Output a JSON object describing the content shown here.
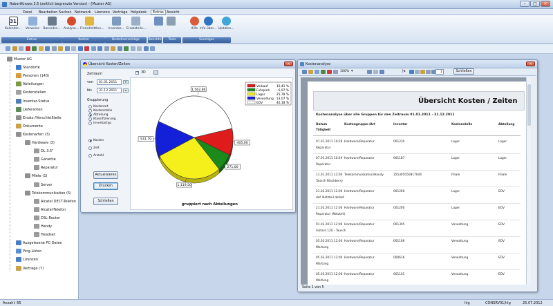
{
  "window": {
    "title": "RobertKnows 3.5 (zeitlich begrenzte Version) - [Muster AG]"
  },
  "menu": [
    "Datei",
    "Bearbeiten",
    "Suchen",
    "Netzwerk",
    "Lizenzen",
    "Verträge",
    "Helpdesk",
    "Extras",
    "Ansicht"
  ],
  "menu_active": "Extras",
  "ribbon": {
    "buttons": [
      {
        "label": "Kalender...",
        "icon": "calendar-icon",
        "badge": "31"
      },
      {
        "label": "Verweise",
        "icon": "links-icon"
      },
      {
        "label": "Barcodes...",
        "icon": "barcode-icon"
      },
      {
        "label": "Analyse...",
        "icon": "analysis-icon"
      },
      {
        "label": "Fremdmittlon...",
        "icon": "finance-icon"
      },
      {
        "label": "Inventar...",
        "icon": "inventory-icon"
      },
      {
        "label": "Ersatzteile...",
        "icon": "spare-parts-icon"
      },
      {
        "label": "",
        "icon": "report-icon"
      },
      {
        "label": "",
        "icon": "tools-icon"
      },
      {
        "label": "Hilfe",
        "icon": "help-icon"
      },
      {
        "label": "Info über...",
        "icon": "info-icon"
      },
      {
        "label": "Updates...",
        "icon": "updates-icon"
      }
    ],
    "groups": [
      "Extras",
      "Kosten",
      "Bestellvorschläge",
      "Berichte",
      "Tools",
      "Sonstiges"
    ]
  },
  "tree": [
    {
      "label": "Muster AG",
      "level": 0,
      "color": "#8c8c8c"
    },
    {
      "label": "Standorte",
      "level": 1,
      "color": "#3c7cc7"
    },
    {
      "label": "Personen (143)",
      "level": 1,
      "color": "#d99b3a"
    },
    {
      "label": "Abteilungen",
      "level": 1,
      "color": "#7a9a3f"
    },
    {
      "label": "Kostenstellen",
      "level": 1,
      "color": "#a0a0a0"
    },
    {
      "label": "Inventar-Status",
      "level": 1,
      "color": "#4f7fb5"
    },
    {
      "label": "Lieferanten",
      "level": 1,
      "color": "#5a8f5a"
    },
    {
      "label": "Ersatz-/Verschleißteile",
      "level": 1,
      "color": "#8f8f8f"
    },
    {
      "label": "Dokumente",
      "level": 1,
      "color": "#c9a34a"
    },
    {
      "label": "Kostenarten (3)",
      "level": 1,
      "color": "#8f8f8f"
    },
    {
      "label": "Hardware (3)",
      "level": 2,
      "color": "#8f8f8f"
    },
    {
      "label": "DL 3.5\"",
      "level": 3,
      "color": "#9a9a9a"
    },
    {
      "label": "Garantie",
      "level": 3,
      "color": "#9a9a9a"
    },
    {
      "label": "Reparatur",
      "level": 3,
      "color": "#9a9a9a"
    },
    {
      "label": "Miete (1)",
      "level": 2,
      "color": "#8f8f8f"
    },
    {
      "label": "Server",
      "level": 3,
      "color": "#9a9a9a"
    },
    {
      "label": "Telekommunikation (5)",
      "level": 2,
      "color": "#8f8f8f"
    },
    {
      "label": "Alcatel DECT-Telefon",
      "level": 3,
      "color": "#9a9a9a"
    },
    {
      "label": "Alcatel-Telefon",
      "level": 3,
      "color": "#9a9a9a"
    },
    {
      "label": "DSL-Router",
      "level": 3,
      "color": "#9a9a9a"
    },
    {
      "label": "Handy",
      "level": 3,
      "color": "#9a9a9a"
    },
    {
      "label": "Headset",
      "level": 3,
      "color": "#9a9a9a"
    },
    {
      "label": "Ausgelesene PC-Daten",
      "level": 1,
      "color": "#4a7fc4"
    },
    {
      "label": "Ping-Listen",
      "level": 1,
      "color": "#5b8fd0"
    },
    {
      "label": "Lizenzen",
      "level": 1,
      "color": "#4a7fc4"
    },
    {
      "label": "Verträge (7)",
      "level": 1,
      "color": "#c9a34a"
    }
  ],
  "cost_window": {
    "title": "Übersicht Kosten/Zeiten",
    "zeitraum_label": "Zeitraum",
    "von_label": "von",
    "von_value": "01.01.2011",
    "bis_label": "bis",
    "bis_value": "31.12.2011",
    "gruppierung_label": "Gruppierung",
    "gruppierung_options": [
      "Kostenart",
      "Kostenstelle",
      "Abteilung",
      "Klassifizierung",
      "Inventartyp"
    ],
    "gruppierung_selected": 2,
    "mode_options": [
      "Kosten",
      "Zeit",
      "Anzahl"
    ],
    "mode_selected": 0,
    "check_3d": "3D",
    "buttons": {
      "refresh": "Aktualisieren",
      "print": "Drucken",
      "close": "Schließen"
    },
    "caption": "gruppiert nach Abteilungen"
  },
  "chart_data": {
    "type": "pie",
    "categories": [
      "Verkauf",
      "Fuhrpark",
      "Lager",
      "Verwaltung",
      "EDV"
    ],
    "legend_percent": [
      "10,41 %",
      "6,97 %",
      "25,78 %",
      "13,07 %",
      "40,18 %"
    ],
    "values": [
      405.0,
      271.0,
      1119.5,
      531.79,
      1562.86
    ],
    "value_labels": [
      "405,00",
      "271,00",
      "1.119,50",
      "531,79",
      "1.562,86"
    ],
    "colors": [
      "#e01b1b",
      "#1a8a1a",
      "#f5ef1c",
      "#1420d8",
      "#ffffff"
    ],
    "legend": "top-right",
    "three_d": true
  },
  "report_window": {
    "title": "Kostenanalyse",
    "zoom": "100%",
    "page_current": "1",
    "page_total": "5",
    "close_label": "Schließen",
    "heading": "Übersicht Kosten / Zeiten",
    "subtitle": "Kostenanalyse über alle Gruppen für den Zeitraum 01.01.2011 - 31.12.2011",
    "columns": [
      "Datum",
      "Kostengruppe-/Art",
      "Inventar",
      "Kostenstelle",
      "Abteilung"
    ],
    "col2_label": "Tätigkeit",
    "rows": [
      {
        "datum": "07.01.2011 10:28",
        "gruppe": "Hardware/Reparatur",
        "inventar": "001230",
        "kst": "Lager",
        "abt": "Lager",
        "taetigkeit": "Reparatur"
      },
      {
        "datum": "07.01.2011 10:29",
        "gruppe": "Hardware/Reparatur",
        "inventar": "001187",
        "kst": "Lager",
        "abt": "Lager",
        "taetigkeit": "Reparatur"
      },
      {
        "datum": "11.01.2011 12:00",
        "gruppe": "Telekommunikation/Handy",
        "inventar": "355305050817044",
        "kst": "Filiale",
        "abt": "Filiale",
        "taetigkeit": "Tausch Blackberry"
      },
      {
        "datum": "21.02.2011 12:00",
        "gruppe": "Hardware/Reparatur",
        "inventar": "001200",
        "kst": "Lager",
        "abt": "EDV",
        "taetigkeit": "def. Netzteil defekt"
      },
      {
        "datum": "21.02.2011 12:00",
        "gruppe": "Hardware/Reparatur",
        "inventar": "001200",
        "kst": "Lager",
        "abt": "EDV",
        "taetigkeit": "Reparatur (Netzteil)"
      },
      {
        "datum": "01.03.2011 12:00",
        "gruppe": "Hardware/Reparatur",
        "inventar": "001305",
        "kst": "Verwaltung",
        "abt": "EDV",
        "taetigkeit": "Asitaro 120 - Tausch"
      },
      {
        "datum": "05.03.2011 12:00",
        "gruppe": "Hardware/Reparatur",
        "inventar": "001166",
        "kst": "Verwaltung",
        "abt": "EDV",
        "taetigkeit": "Wartung"
      },
      {
        "datum": "05.03.2011 12:00",
        "gruppe": "Hardware/Reparatur",
        "inventar": "000616",
        "kst": "Verwaltung",
        "abt": "EDV",
        "taetigkeit": "Wartung"
      },
      {
        "datum": "05.03.2011 12:00",
        "gruppe": "Hardware/Reparatur",
        "inventar": "001101",
        "kst": "Verwaltung",
        "abt": "EDV",
        "taetigkeit": "Wartung"
      }
    ],
    "footer": "Seite 1 von 5"
  },
  "status": {
    "left": "Anzahl: 66",
    "hlg": "hlg",
    "conn": "CONSRV01/hlg",
    "date": "25.07.2012"
  }
}
